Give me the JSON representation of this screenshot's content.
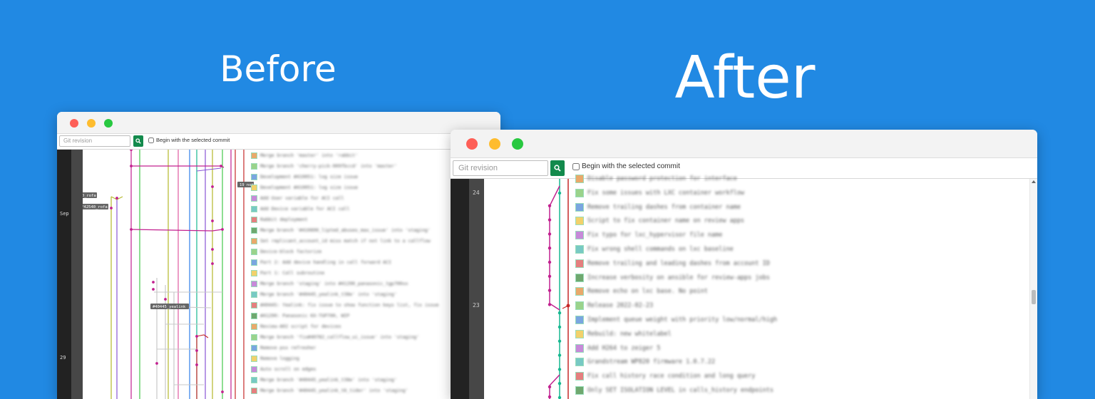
{
  "headings": {
    "before": "Before",
    "after": "After"
  },
  "toolbar": {
    "revision_placeholder": "Git revision",
    "checkbox_label": "Begin with the selected commit",
    "checkbox_checked": false
  },
  "before": {
    "date_labels": [
      {
        "text": "Sep",
        "row": 5.5
      },
      {
        "text": "29",
        "row": 19
      }
    ],
    "ref_labels": [
      "feat/42540_rofa",
      "feat/42540_rofa",
      "19 notes",
      "#40445_yealink"
    ],
    "commits": [
      "Merge branch 'master' into 'rabbit'",
      "Merge branch 'cherry-pick-009fbccd' into 'master'",
      "Development #410051: log size issue",
      "Development #410051: log size issue",
      "Add User variable for ACI call",
      "Add Device variable for ACI call",
      "Rabbit deployment",
      "Merge branch '#410890_lipted_abuses_max_issue' into 'staging'",
      "Set replicant_account_id miss match if not link to a callflow",
      "Device-block factorize",
      "Part 2: Add device handling in call forward ACI",
      "Part 1: Call subroutine",
      "Merge branch 'staging' into #41290_panasonic_tgp700xx",
      "Merge branch '#40445_yealink_t38e' into 'staging'",
      "#40445: Yealink: fix issue to show function keys list, fix issue",
      "#41290: Panasonic KX-TGP700, WIP",
      "Review-A02 script for devices",
      "Merge branch 'fix#40782_callflow_ui_issue' into 'staging'",
      "Remove psx refresher",
      "Remove logging",
      "Auto scroll on edges",
      "Merge branch '#40445_yealink_t38e' into 'staging'",
      "Merge branch '#40445_yealink_t6_tider' into 'staging'"
    ]
  },
  "after": {
    "date_labels": [
      {
        "text": "24",
        "row": 1
      },
      {
        "text": "23",
        "row": 9
      }
    ],
    "commits": [
      "Disable password protection for interface",
      "Fix some issues with LXC container workflow",
      "Remove trailing dashes from container name",
      "Script to fix container name on review apps",
      "Fix typo for lxc_hypervisor file name",
      "Fix wrong shell commands on lxc baseline",
      "Remove trailing and leading dashes from account ID",
      "Increase verbosity on ansible for review-apps jobs",
      "Remove echo on lxc base. No point",
      "Release 2022-02-23",
      "Implement queue weight with priority low/normal/high",
      "Rebuild: new whitelabel",
      "Add H264 to zeiger 5",
      "Grandstream WP820 firmware 1.0.7.22",
      "Fix call history race condition and long query",
      "Only SET ISOLATION LEVEL in calls_history endpoints"
    ]
  },
  "colors": {
    "background": "#2189e3",
    "search_button": "#138a4c",
    "magenta": "#c2208f",
    "teal": "#17b890",
    "red": "#c62828",
    "green": "#43c84a",
    "purple": "#8855d6",
    "blue": "#2f7ee8",
    "olive": "#b5b82a",
    "pink": "#e05ba0",
    "gray": "#c8c8c8"
  }
}
